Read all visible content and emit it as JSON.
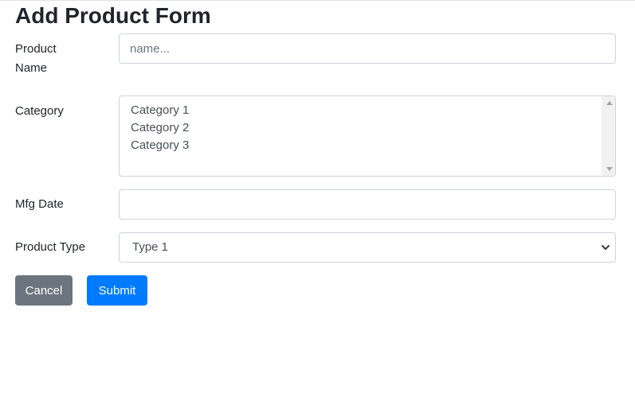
{
  "form": {
    "title": "Add Product Form",
    "product_name": {
      "label": "Product Name",
      "placeholder": "name...",
      "value": ""
    },
    "category": {
      "label": "Category",
      "options": [
        "Category 1",
        "Category 2",
        "Category 3"
      ]
    },
    "mfg_date": {
      "label": "Mfg Date",
      "value": ""
    },
    "product_type": {
      "label": "Product Type",
      "selected": "Type 1"
    },
    "buttons": {
      "cancel": "Cancel",
      "submit": "Submit"
    }
  },
  "colors": {
    "cancel_bg": "#6c757d",
    "submit_bg": "#007bff",
    "border": "#ced4da"
  },
  "icons": {
    "select_arrow": "chevron-down-icon",
    "scroll_up": "scroll-up-arrow-icon",
    "scroll_down": "scroll-down-arrow-icon"
  }
}
